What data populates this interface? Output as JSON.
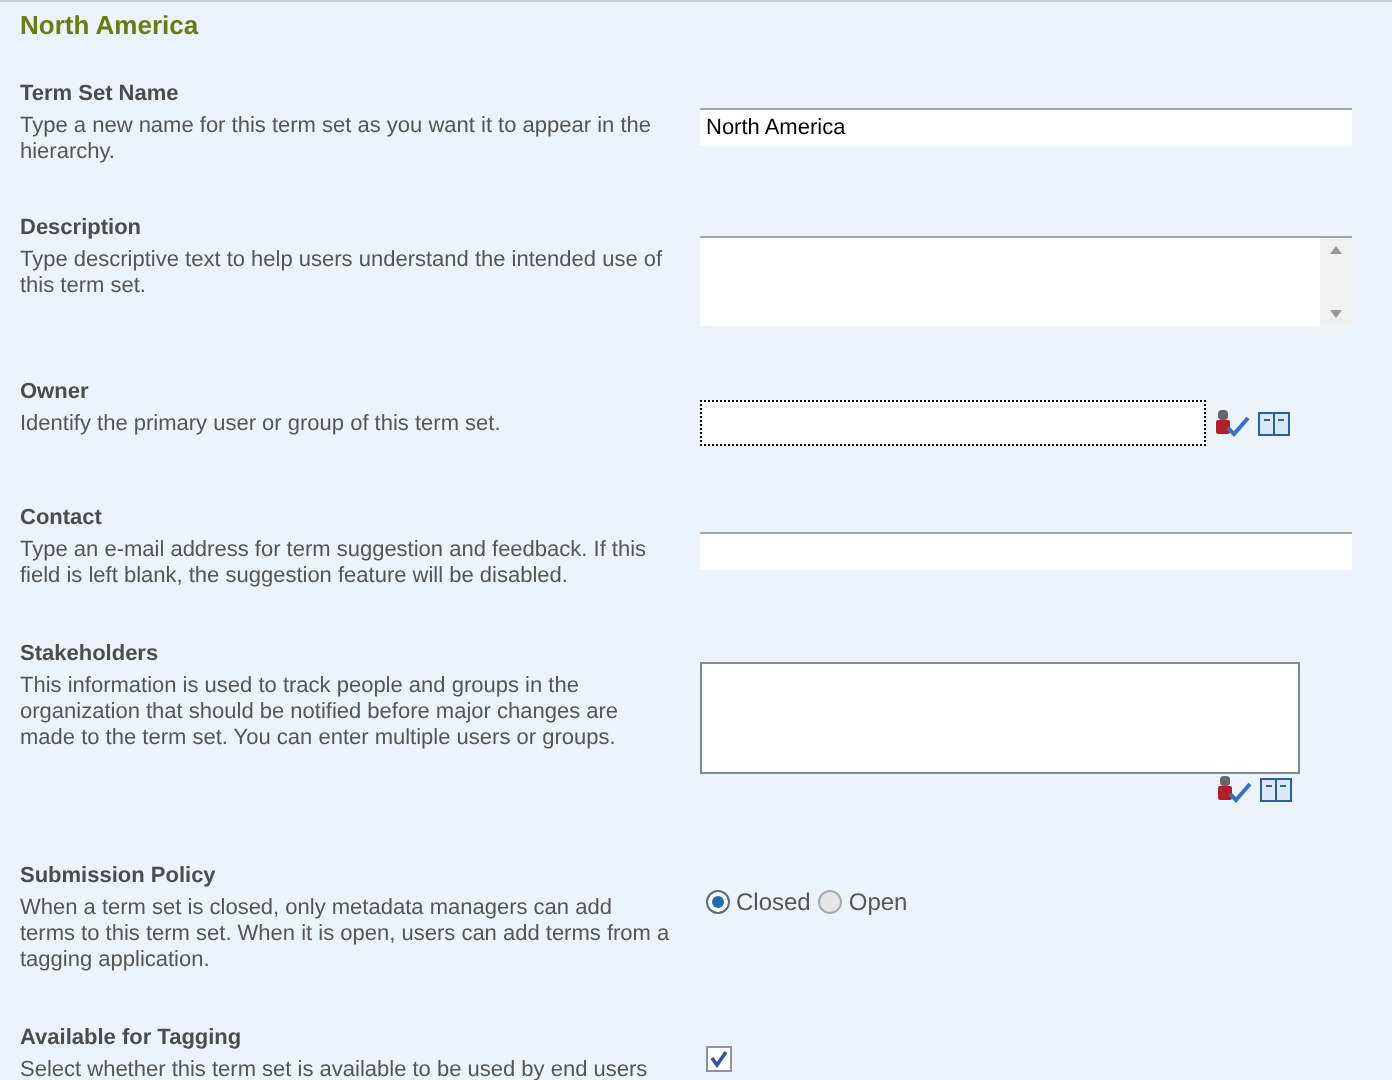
{
  "title": "North America",
  "sections": [
    {
      "kind": "text",
      "heading": "Term Set Name",
      "description": "Type a new name for this term set as you want it to appear in the hierarchy.",
      "value": "North America"
    },
    {
      "kind": "textarea",
      "heading": "Description",
      "description": "Type descriptive text to help users understand the intended use of this term set."
    },
    {
      "kind": "people",
      "heading": "Owner",
      "description": "Identify the primary user or group of this term set.",
      "focused": true
    },
    {
      "kind": "text",
      "heading": "Contact",
      "description": "Type an e-mail address for term suggestion and feedback. If this field is left blank, the suggestion feature will be disabled."
    },
    {
      "kind": "people_multi",
      "heading": "Stakeholders",
      "description": "This information is used to track people and groups in the organization that should be notified before major changes are made to the term set. You can enter multiple users or groups."
    },
    {
      "kind": "radio",
      "heading": "Submission Policy",
      "description": "When a term set is closed, only metadata managers can add terms to this term set. When it is open, users can add terms from a tagging application.",
      "options": [
        {
          "label": "Closed",
          "selected": true
        },
        {
          "label": "Open",
          "selected": false
        }
      ]
    },
    {
      "kind": "checkbox",
      "heading": "Available for Tagging",
      "description": "Select whether this term set is available to be used by end users",
      "checked": true
    }
  ]
}
